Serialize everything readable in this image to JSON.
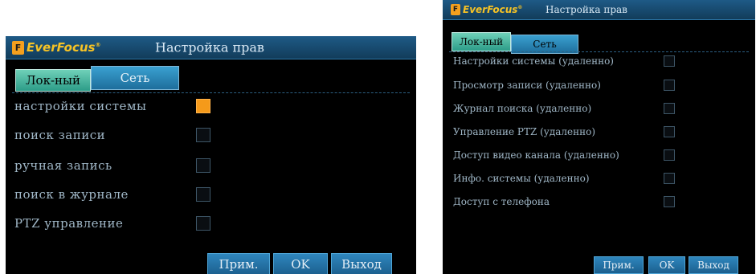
{
  "brand": {
    "logo_mark": "F",
    "logo_text": "EverFocus",
    "logo_suffix": "®"
  },
  "screen_local": {
    "title": "Настройка прав",
    "tabs": [
      {
        "label": "Лок-ный",
        "active": true
      },
      {
        "label": "Сеть",
        "active": false
      }
    ],
    "permissions": [
      {
        "label": "настройки системы",
        "checked": true
      },
      {
        "label": "поиск записи",
        "checked": false
      },
      {
        "label": "ручная запись",
        "checked": false
      },
      {
        "label": "поиск в журнале",
        "checked": false
      },
      {
        "label": "PTZ управление",
        "checked": false
      }
    ],
    "buttons": {
      "apply": "Прим.",
      "ok": "OK",
      "exit": "Выход"
    }
  },
  "screen_network": {
    "title": "Настройка прав",
    "tabs": [
      {
        "label": "Лок-ный",
        "active": false
      },
      {
        "label": "Сеть",
        "active": true
      }
    ],
    "permissions": [
      {
        "label": "Настройки системы (удаленно)",
        "checked": false
      },
      {
        "label": "Просмотр записи (удаленно)",
        "checked": false
      },
      {
        "label": "Журнал поиска (удаленно)",
        "checked": false
      },
      {
        "label": "Управление PTZ (удаленно)",
        "checked": false
      },
      {
        "label": "Доступ видео канала (удаленно)",
        "checked": false
      },
      {
        "label": "Инфо. системы (удаленно)",
        "checked": false
      },
      {
        "label": "Доступ с телефона",
        "checked": false
      }
    ],
    "buttons": {
      "apply": "Прим.",
      "ok": "OK",
      "exit": "Выход"
    }
  },
  "colors": {
    "accent_orange": "#f59a1a",
    "titlebar_blue": "#1e5a86",
    "tab_active": "#2c9c88",
    "label_gray": "#9fb6c6"
  }
}
